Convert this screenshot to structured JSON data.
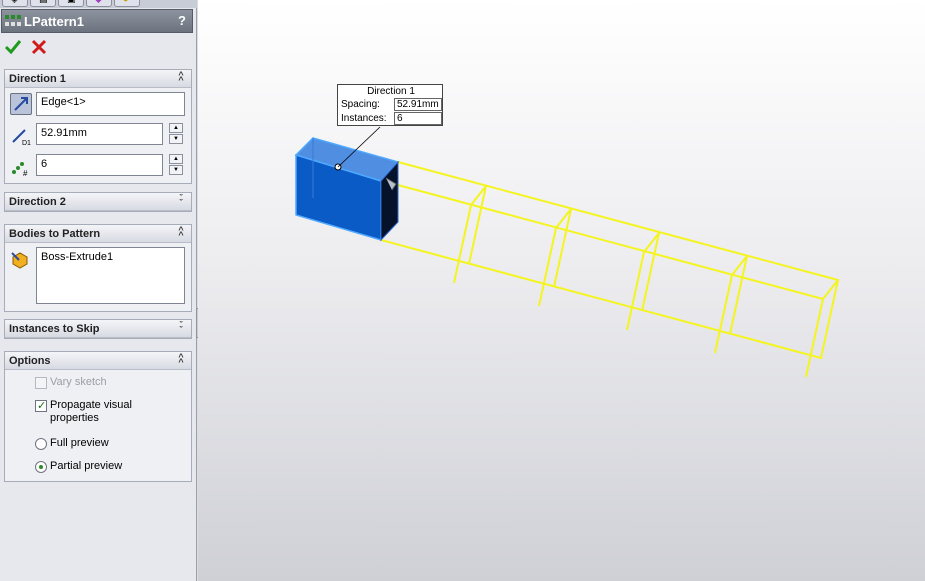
{
  "feature": {
    "title": "LPattern1",
    "help": "?"
  },
  "direction1": {
    "header": "Direction 1",
    "edge_value": "Edge<1>",
    "spacing_value": "52.91mm",
    "instances_value": "6"
  },
  "direction2": {
    "header": "Direction 2"
  },
  "bodies": {
    "header": "Bodies to Pattern",
    "items": [
      "Boss-Extrude1"
    ]
  },
  "skip": {
    "header": "Instances to Skip"
  },
  "options": {
    "header": "Options",
    "vary_sketch": "Vary sketch",
    "propagate": "Propagate visual properties",
    "full_preview": "Full preview",
    "partial_preview": "Partial preview"
  },
  "callout": {
    "title": "Direction 1",
    "spacing_label": "Spacing:",
    "spacing_value": "52.91mm",
    "instances_label": "Instances:",
    "instances_value": "6"
  },
  "colors": {
    "body_fill": "#0a5bc6",
    "preview_stroke": "#f4f420",
    "accept": "#1f9a1f",
    "cancel": "#d11a1a"
  }
}
